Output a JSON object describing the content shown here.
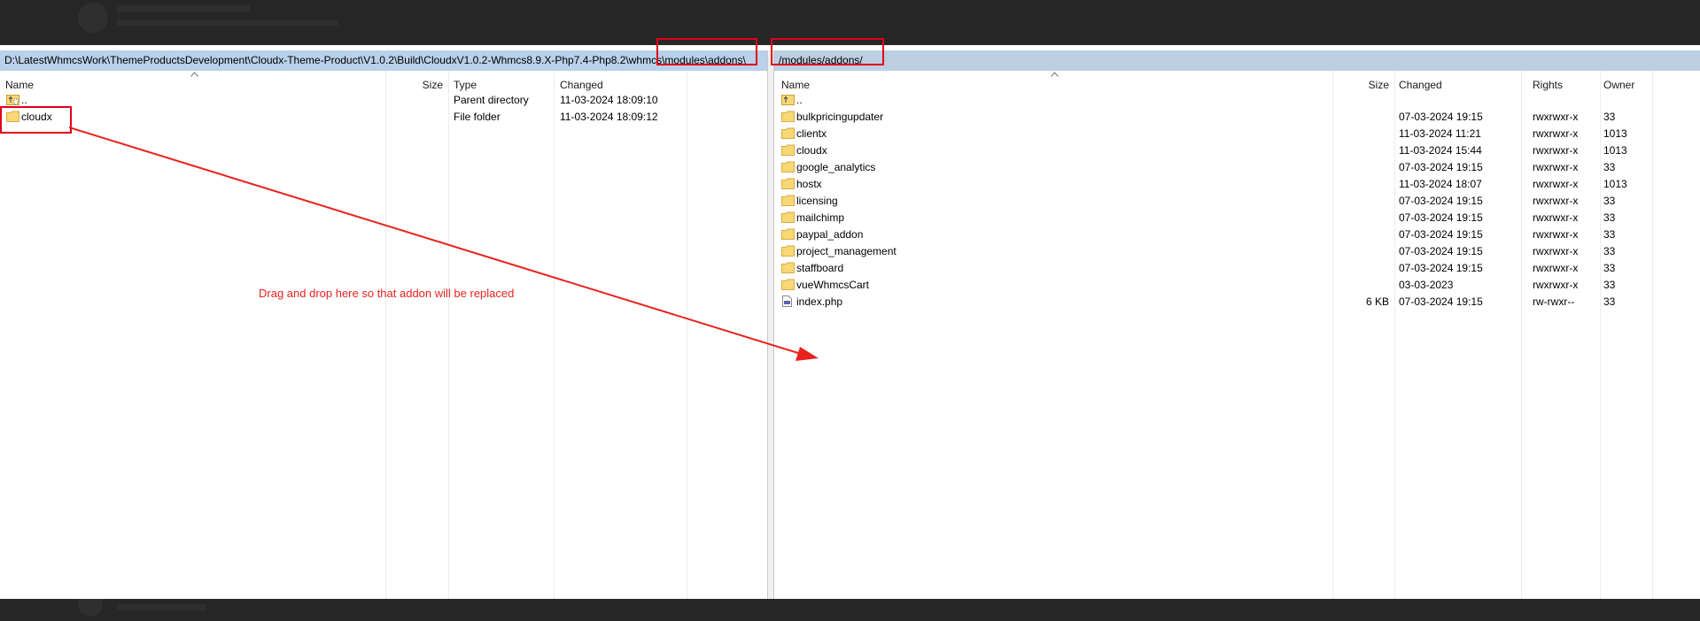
{
  "left_panel": {
    "path": "D:\\LatestWhmcsWork\\ThemeProductsDevelopment\\Cloudx-Theme-Product\\V1.0.2\\Build\\CloudxV1.0.2-Whmcs8.9.X-Php7.4-Php8.2\\whmcs\\modules\\addons\\",
    "columns": [
      "Name",
      "Size",
      "Type",
      "Changed"
    ],
    "rows": [
      {
        "name": "..",
        "size": "",
        "type": "Parent directory",
        "changed": "11-03-2024 18:09:10",
        "icon": "parent-dir-icon"
      },
      {
        "name": "cloudx",
        "size": "",
        "type": "File folder",
        "changed": "11-03-2024 18:09:12",
        "icon": "folder-icon"
      }
    ]
  },
  "right_panel": {
    "path": "/modules/addons/",
    "columns": [
      "Name",
      "Size",
      "Changed",
      "Rights",
      "Owner"
    ],
    "rows": [
      {
        "name": "..",
        "size": "",
        "changed": "",
        "rights": "",
        "owner": "",
        "icon": "parent-dir-icon"
      },
      {
        "name": "bulkpricingupdater",
        "size": "",
        "changed": "07-03-2024 19:15",
        "rights": "rwxrwxr-x",
        "owner": "33",
        "icon": "folder-icon"
      },
      {
        "name": "clientx",
        "size": "",
        "changed": "11-03-2024 11:21",
        "rights": "rwxrwxr-x",
        "owner": "1013",
        "icon": "folder-icon"
      },
      {
        "name": "cloudx",
        "size": "",
        "changed": "11-03-2024 15:44",
        "rights": "rwxrwxr-x",
        "owner": "1013",
        "icon": "folder-icon"
      },
      {
        "name": "google_analytics",
        "size": "",
        "changed": "07-03-2024 19:15",
        "rights": "rwxrwxr-x",
        "owner": "33",
        "icon": "folder-icon"
      },
      {
        "name": "hostx",
        "size": "",
        "changed": "11-03-2024 18:07",
        "rights": "rwxrwxr-x",
        "owner": "1013",
        "icon": "folder-icon"
      },
      {
        "name": "licensing",
        "size": "",
        "changed": "07-03-2024 19:15",
        "rights": "rwxrwxr-x",
        "owner": "33",
        "icon": "folder-icon"
      },
      {
        "name": "mailchimp",
        "size": "",
        "changed": "07-03-2024 19:15",
        "rights": "rwxrwxr-x",
        "owner": "33",
        "icon": "folder-icon"
      },
      {
        "name": "paypal_addon",
        "size": "",
        "changed": "07-03-2024 19:15",
        "rights": "rwxrwxr-x",
        "owner": "33",
        "icon": "folder-icon"
      },
      {
        "name": "project_management",
        "size": "",
        "changed": "07-03-2024 19:15",
        "rights": "rwxrwxr-x",
        "owner": "33",
        "icon": "folder-icon"
      },
      {
        "name": "staffboard",
        "size": "",
        "changed": "07-03-2024 19:15",
        "rights": "rwxrwxr-x",
        "owner": "33",
        "icon": "folder-icon"
      },
      {
        "name": "vueWhmcsCart",
        "size": "",
        "changed": "03-03-2023",
        "rights": "rwxrwxr-x",
        "owner": "33",
        "icon": "folder-icon"
      },
      {
        "name": "index.php",
        "size": "6 KB",
        "changed": "07-03-2024 19:15",
        "rights": "rw-rwxr--",
        "owner": "33",
        "icon": "php-file-icon"
      }
    ]
  },
  "annotation": {
    "note": "Drag and drop here so that addon will be replaced",
    "color": "#e8231e"
  },
  "colors": {
    "path_bar_left": "#b9d1ea",
    "path_bar_right": "#bccfe3",
    "folder": "#f8d775",
    "callout": "#e0001a"
  }
}
